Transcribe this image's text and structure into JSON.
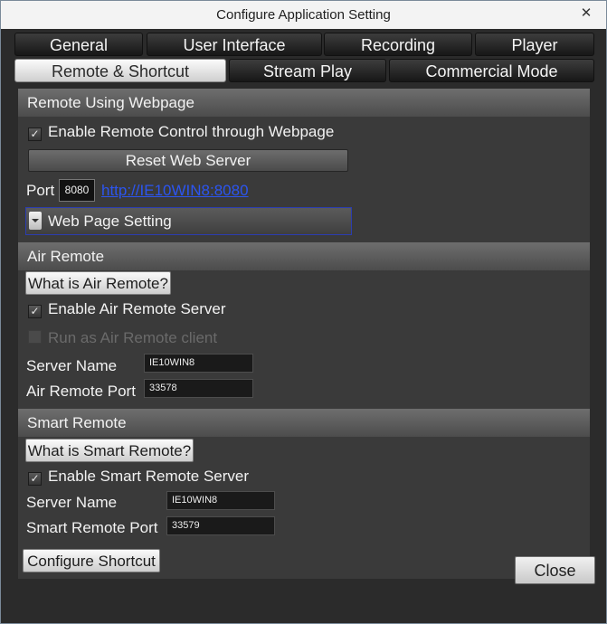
{
  "window": {
    "title": "Configure Application Setting",
    "close_glyph": "✕",
    "close_button_label": "Close"
  },
  "tabs": {
    "row1": [
      "General",
      "User Interface",
      "Recording",
      "Player"
    ],
    "row2": [
      "Remote & Shortcut",
      "Stream Play",
      "Commercial Mode"
    ],
    "active": "Remote & Shortcut"
  },
  "webpage": {
    "header": "Remote Using Webpage",
    "enable_label": "Enable Remote Control through Webpage",
    "enable_checked": true,
    "reset_button": "Reset Web Server",
    "port_label": "Port",
    "port_value": "8080",
    "url_link": "http://IE10WIN8:8080",
    "expander_label": "Web Page Setting"
  },
  "air_remote": {
    "header": "Air Remote",
    "help_button": "What is Air Remote?",
    "enable_label": "Enable Air Remote Server",
    "enable_checked": true,
    "client_label": "Run as Air Remote client",
    "client_checked": false,
    "server_name_label": "Server Name",
    "server_name_value": "IE10WIN8",
    "port_label": "Air Remote Port",
    "port_value": "33578"
  },
  "smart_remote": {
    "header": "Smart Remote",
    "help_button": "What is Smart Remote?",
    "enable_label": "Enable Smart Remote Server",
    "enable_checked": true,
    "server_name_label": "Server Name",
    "server_name_value": "IE10WIN8",
    "port_label": "Smart Remote Port",
    "port_value": "33579"
  },
  "shortcut": {
    "configure_button": "Configure Shortcut"
  },
  "checkbox_glyph": "✓"
}
